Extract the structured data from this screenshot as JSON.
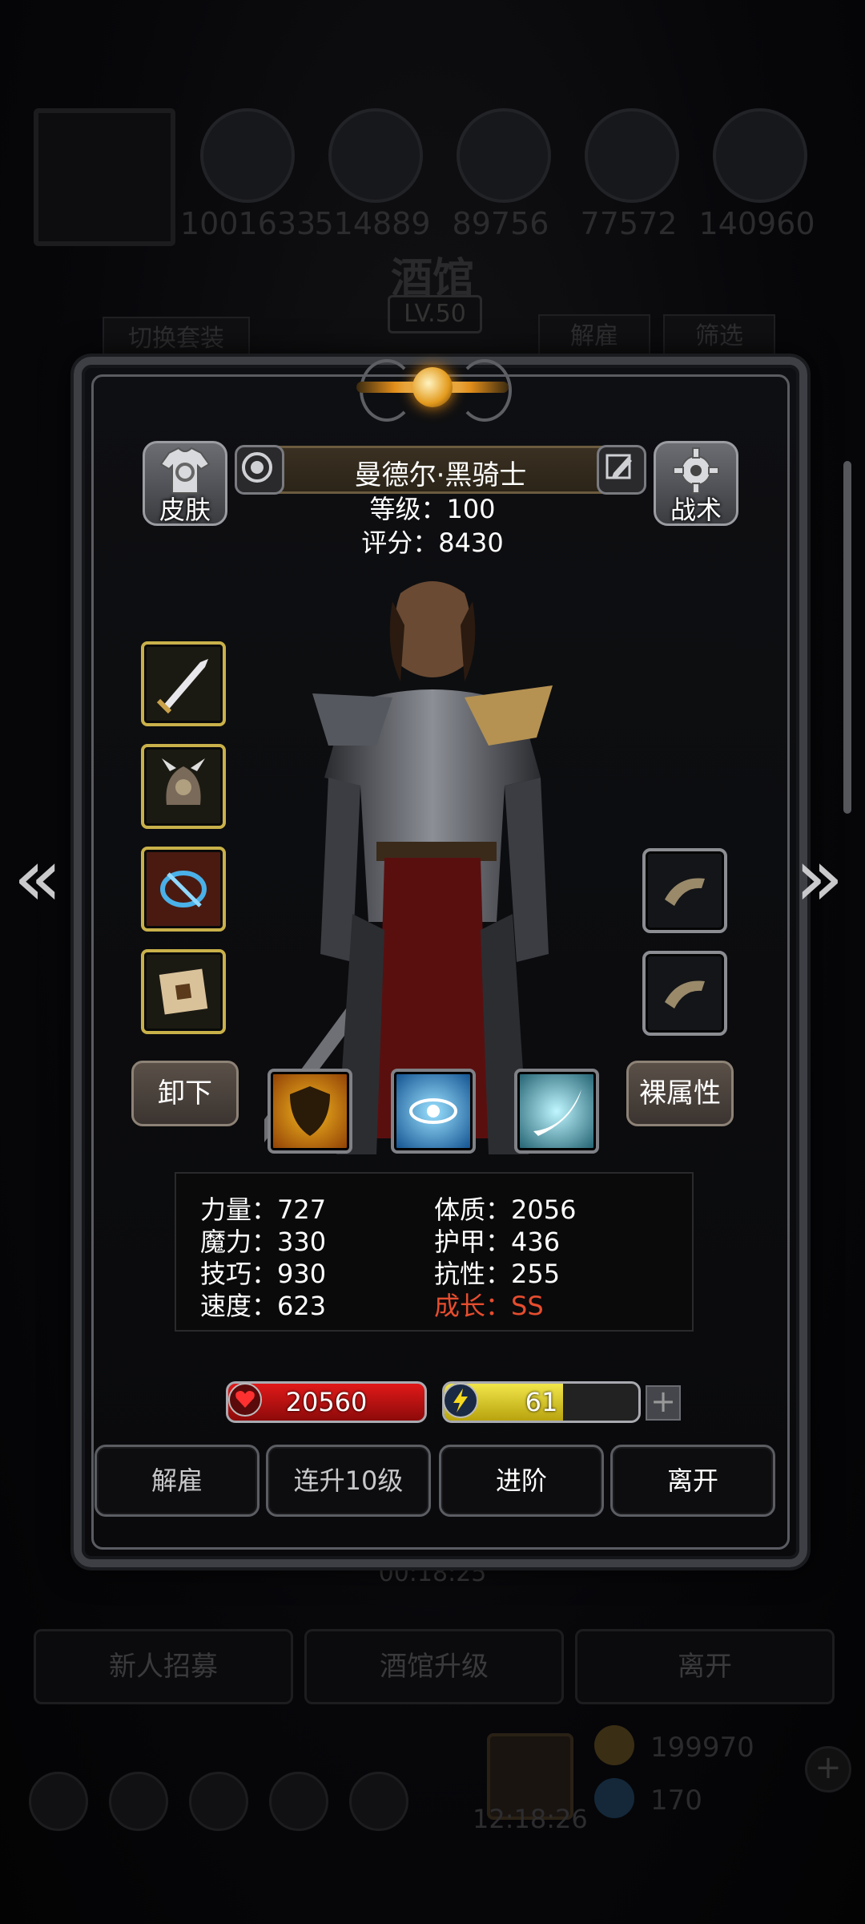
{
  "background": {
    "resources": [
      "1001633",
      "514889",
      "89756",
      "77572",
      "140960"
    ],
    "title": "酒馆",
    "level": "LV.50",
    "btn_switch_outfit": "切换套装",
    "btn_dismiss": "解雇",
    "btn_filter": "筛选",
    "timer": "00:18:25",
    "bottom_buttons": [
      "新人招募",
      "酒馆升级",
      "离开"
    ],
    "gold": "199970",
    "gems": "170",
    "clock": "12:18:26"
  },
  "hero": {
    "name": "曼德尔·黑骑士",
    "level_line": "等级：100",
    "score_line": "评分：8430",
    "skin_label": "皮肤",
    "tactics_label": "战术",
    "unequip_label": "卸下",
    "naked_attr_label": "裸属性"
  },
  "attributes": {
    "strength": "力量：727",
    "magic": "魔力：330",
    "skill": "技巧：930",
    "speed": "速度：623",
    "constitution": "体质：2056",
    "armor": "护甲：436",
    "resistance": "抗性：255",
    "growth": "成长：SS"
  },
  "bars": {
    "hp": "20560",
    "energy": "61",
    "energy_fraction": 0.61
  },
  "actions": {
    "dismiss": "解雇",
    "level_up_10": "连升10级",
    "advance": "进阶",
    "leave": "离开"
  },
  "colors": {
    "growth_red": "#e54d2e",
    "hp_red": "#e11919",
    "energy_yellow": "#f1e64a",
    "slot_gold": "#c9b14a"
  }
}
